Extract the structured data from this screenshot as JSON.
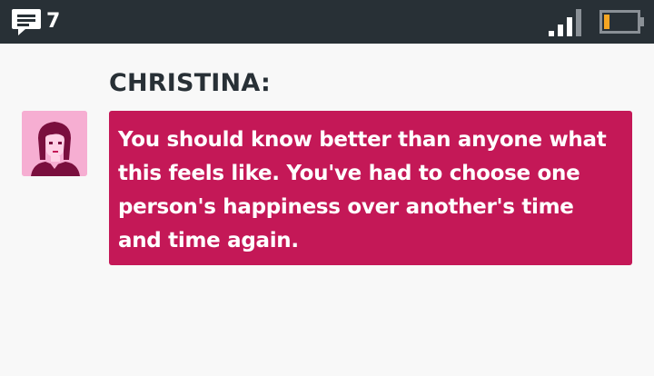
{
  "status_bar": {
    "message_count": "7",
    "message_icon": "chat-bubble-icon",
    "signal_icon": "signal-strength-icon",
    "battery_icon": "battery-low-icon",
    "colors": {
      "background": "#283036",
      "battery_level": "#f5a623",
      "signal_active": "#ffffff",
      "signal_inactive": "#8a9096"
    }
  },
  "dialogue": {
    "speaker": "CHRISTINA:",
    "text": "You should know better than anyone what this feels like. You've had to choose one person's happiness over another's time and time again.",
    "avatar_icon": "christina-portrait-icon",
    "colors": {
      "bubble": "#c41857",
      "avatar_background": "#f6aed2",
      "speaker_text": "#283036"
    }
  }
}
